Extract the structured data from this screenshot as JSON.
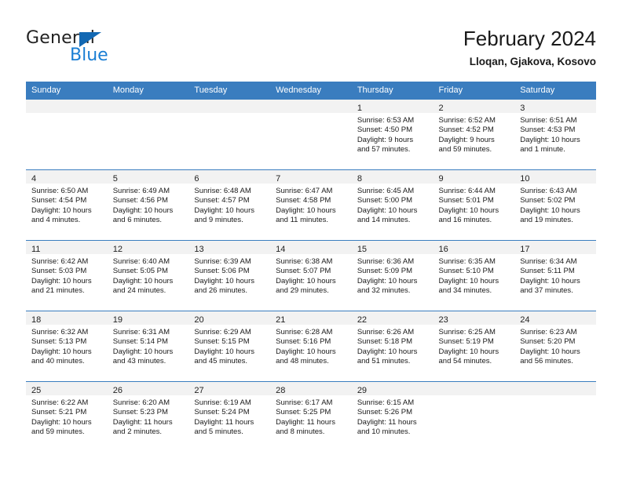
{
  "brand": {
    "word_one": "General",
    "word_two": "Blue",
    "triangle_color": "#1268b3",
    "blue_color": "#1b7fd4"
  },
  "header": {
    "title": "February 2024",
    "subtitle": "Lloqan, Gjakova, Kosovo"
  },
  "theme": {
    "header_row_bg": "#3a7dbf",
    "daynum_band_bg": "#f2f2f2",
    "grid_line": "#3a7dbf"
  },
  "weekday_headers": [
    "Sunday",
    "Monday",
    "Tuesday",
    "Wednesday",
    "Thursday",
    "Friday",
    "Saturday"
  ],
  "weeks": [
    [
      {
        "day": "",
        "lines": []
      },
      {
        "day": "",
        "lines": []
      },
      {
        "day": "",
        "lines": []
      },
      {
        "day": "",
        "lines": []
      },
      {
        "day": "1",
        "lines": [
          "Sunrise: 6:53 AM",
          "Sunset: 4:50 PM",
          "Daylight: 9 hours",
          "and 57 minutes."
        ]
      },
      {
        "day": "2",
        "lines": [
          "Sunrise: 6:52 AM",
          "Sunset: 4:52 PM",
          "Daylight: 9 hours",
          "and 59 minutes."
        ]
      },
      {
        "day": "3",
        "lines": [
          "Sunrise: 6:51 AM",
          "Sunset: 4:53 PM",
          "Daylight: 10 hours",
          "and 1 minute."
        ]
      }
    ],
    [
      {
        "day": "4",
        "lines": [
          "Sunrise: 6:50 AM",
          "Sunset: 4:54 PM",
          "Daylight: 10 hours",
          "and 4 minutes."
        ]
      },
      {
        "day": "5",
        "lines": [
          "Sunrise: 6:49 AM",
          "Sunset: 4:56 PM",
          "Daylight: 10 hours",
          "and 6 minutes."
        ]
      },
      {
        "day": "6",
        "lines": [
          "Sunrise: 6:48 AM",
          "Sunset: 4:57 PM",
          "Daylight: 10 hours",
          "and 9 minutes."
        ]
      },
      {
        "day": "7",
        "lines": [
          "Sunrise: 6:47 AM",
          "Sunset: 4:58 PM",
          "Daylight: 10 hours",
          "and 11 minutes."
        ]
      },
      {
        "day": "8",
        "lines": [
          "Sunrise: 6:45 AM",
          "Sunset: 5:00 PM",
          "Daylight: 10 hours",
          "and 14 minutes."
        ]
      },
      {
        "day": "9",
        "lines": [
          "Sunrise: 6:44 AM",
          "Sunset: 5:01 PM",
          "Daylight: 10 hours",
          "and 16 minutes."
        ]
      },
      {
        "day": "10",
        "lines": [
          "Sunrise: 6:43 AM",
          "Sunset: 5:02 PM",
          "Daylight: 10 hours",
          "and 19 minutes."
        ]
      }
    ],
    [
      {
        "day": "11",
        "lines": [
          "Sunrise: 6:42 AM",
          "Sunset: 5:03 PM",
          "Daylight: 10 hours",
          "and 21 minutes."
        ]
      },
      {
        "day": "12",
        "lines": [
          "Sunrise: 6:40 AM",
          "Sunset: 5:05 PM",
          "Daylight: 10 hours",
          "and 24 minutes."
        ]
      },
      {
        "day": "13",
        "lines": [
          "Sunrise: 6:39 AM",
          "Sunset: 5:06 PM",
          "Daylight: 10 hours",
          "and 26 minutes."
        ]
      },
      {
        "day": "14",
        "lines": [
          "Sunrise: 6:38 AM",
          "Sunset: 5:07 PM",
          "Daylight: 10 hours",
          "and 29 minutes."
        ]
      },
      {
        "day": "15",
        "lines": [
          "Sunrise: 6:36 AM",
          "Sunset: 5:09 PM",
          "Daylight: 10 hours",
          "and 32 minutes."
        ]
      },
      {
        "day": "16",
        "lines": [
          "Sunrise: 6:35 AM",
          "Sunset: 5:10 PM",
          "Daylight: 10 hours",
          "and 34 minutes."
        ]
      },
      {
        "day": "17",
        "lines": [
          "Sunrise: 6:34 AM",
          "Sunset: 5:11 PM",
          "Daylight: 10 hours",
          "and 37 minutes."
        ]
      }
    ],
    [
      {
        "day": "18",
        "lines": [
          "Sunrise: 6:32 AM",
          "Sunset: 5:13 PM",
          "Daylight: 10 hours",
          "and 40 minutes."
        ]
      },
      {
        "day": "19",
        "lines": [
          "Sunrise: 6:31 AM",
          "Sunset: 5:14 PM",
          "Daylight: 10 hours",
          "and 43 minutes."
        ]
      },
      {
        "day": "20",
        "lines": [
          "Sunrise: 6:29 AM",
          "Sunset: 5:15 PM",
          "Daylight: 10 hours",
          "and 45 minutes."
        ]
      },
      {
        "day": "21",
        "lines": [
          "Sunrise: 6:28 AM",
          "Sunset: 5:16 PM",
          "Daylight: 10 hours",
          "and 48 minutes."
        ]
      },
      {
        "day": "22",
        "lines": [
          "Sunrise: 6:26 AM",
          "Sunset: 5:18 PM",
          "Daylight: 10 hours",
          "and 51 minutes."
        ]
      },
      {
        "day": "23",
        "lines": [
          "Sunrise: 6:25 AM",
          "Sunset: 5:19 PM",
          "Daylight: 10 hours",
          "and 54 minutes."
        ]
      },
      {
        "day": "24",
        "lines": [
          "Sunrise: 6:23 AM",
          "Sunset: 5:20 PM",
          "Daylight: 10 hours",
          "and 56 minutes."
        ]
      }
    ],
    [
      {
        "day": "25",
        "lines": [
          "Sunrise: 6:22 AM",
          "Sunset: 5:21 PM",
          "Daylight: 10 hours",
          "and 59 minutes."
        ]
      },
      {
        "day": "26",
        "lines": [
          "Sunrise: 6:20 AM",
          "Sunset: 5:23 PM",
          "Daylight: 11 hours",
          "and 2 minutes."
        ]
      },
      {
        "day": "27",
        "lines": [
          "Sunrise: 6:19 AM",
          "Sunset: 5:24 PM",
          "Daylight: 11 hours",
          "and 5 minutes."
        ]
      },
      {
        "day": "28",
        "lines": [
          "Sunrise: 6:17 AM",
          "Sunset: 5:25 PM",
          "Daylight: 11 hours",
          "and 8 minutes."
        ]
      },
      {
        "day": "29",
        "lines": [
          "Sunrise: 6:15 AM",
          "Sunset: 5:26 PM",
          "Daylight: 11 hours",
          "and 10 minutes."
        ]
      },
      {
        "day": "",
        "lines": []
      },
      {
        "day": "",
        "lines": []
      }
    ]
  ]
}
